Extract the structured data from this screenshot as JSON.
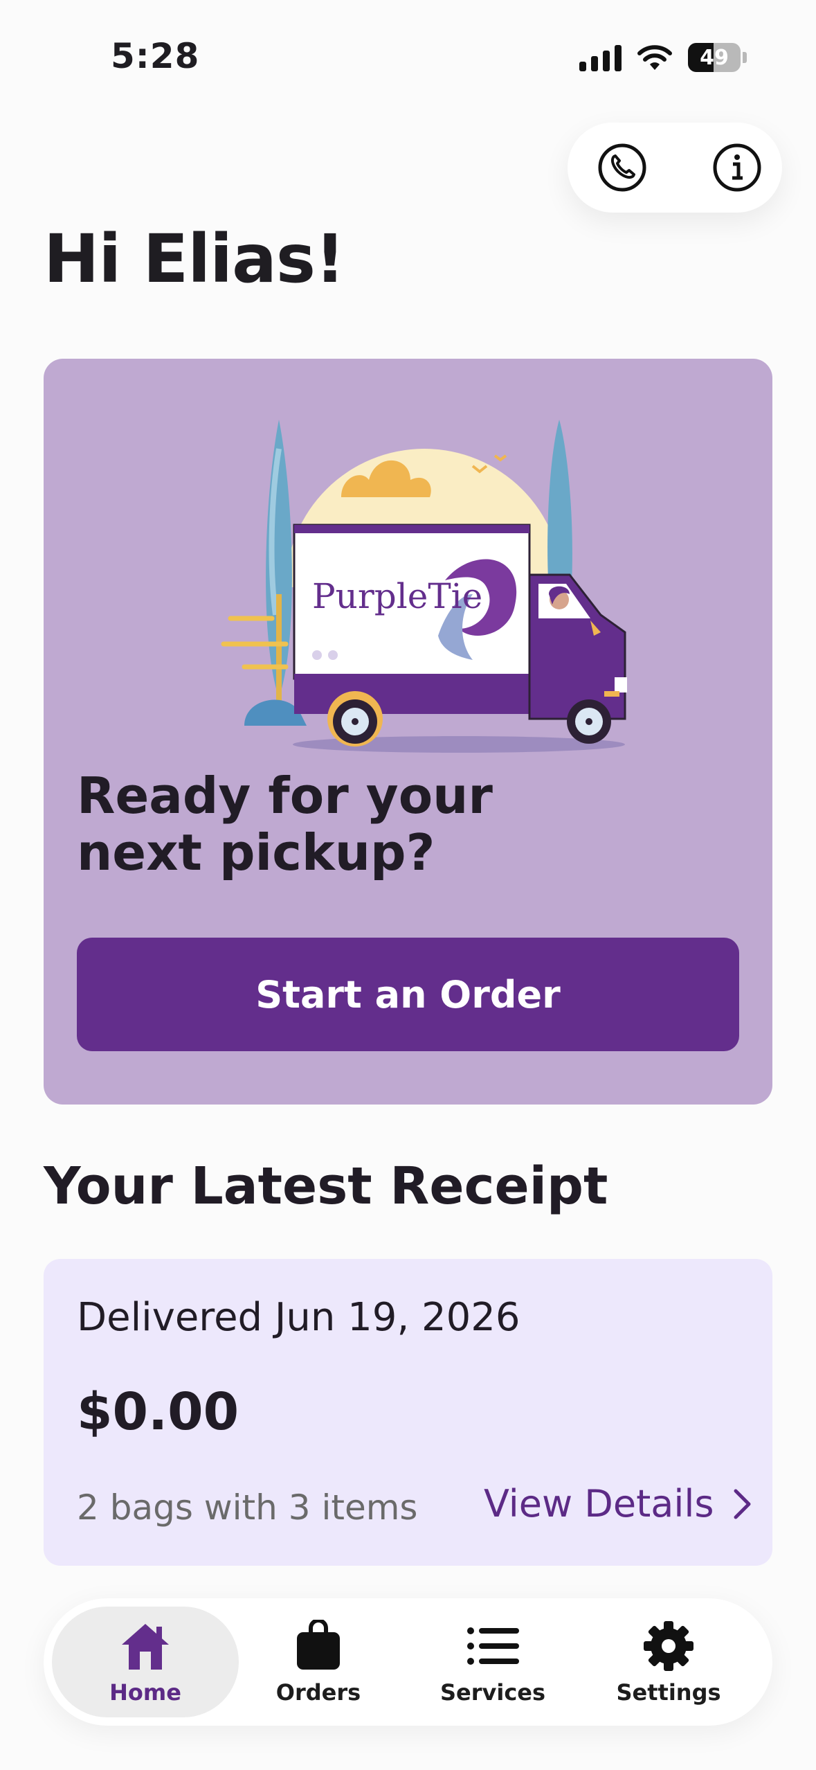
{
  "status_bar": {
    "time": "5:28",
    "battery": "49",
    "battery_level": 0.49
  },
  "header": {
    "greeting": "Hi Elias!",
    "call_icon": "phone-icon",
    "info_icon": "info-icon"
  },
  "hero": {
    "brand_text": "PurpleTie",
    "title_line1": "Ready for your",
    "title_line2": "next pickup?",
    "button_label": "Start an Order",
    "background": "#bfa9d1",
    "button_color": "#632e8c"
  },
  "receipt": {
    "section_title": "Your Latest Receipt",
    "delivered": "Delivered Jun 19, 2026",
    "total": "$0.00",
    "items": "2 bags with 3 items",
    "details_link": "View Details",
    "background": "#ede8fc"
  },
  "tabs": [
    {
      "label": "Home",
      "icon": "home-icon",
      "active": true
    },
    {
      "label": "Orders",
      "icon": "shopping-bag-icon",
      "active": false
    },
    {
      "label": "Services",
      "icon": "list-icon",
      "active": false
    },
    {
      "label": "Settings",
      "icon": "gear-icon",
      "active": false
    }
  ]
}
